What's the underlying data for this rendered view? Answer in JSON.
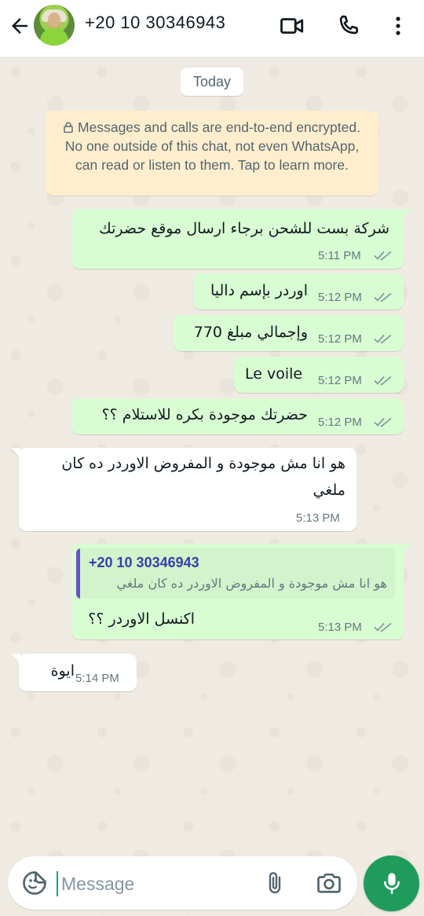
{
  "header": {
    "contact_name": "+20 10 30346943",
    "icons": [
      "back-arrow-icon",
      "avatar",
      "video-call-icon",
      "phone-icon",
      "more-vert-icon"
    ]
  },
  "chat": {
    "date_chip": "Today",
    "encryption_notice": "Messages and calls are end-to-end encrypted. No one outside of this chat, not even WhatsApp, can read or listen to them. Tap to learn more.",
    "messages": [
      {
        "direction": "outgoing",
        "text": "شركة بست للشحن برجاء ارسال موقع حضرتك",
        "time": "5:11 PM",
        "status": "read"
      },
      {
        "direction": "outgoing",
        "text": "اوردر بإسم داليا",
        "time": "5:12 PM",
        "status": "read"
      },
      {
        "direction": "outgoing",
        "text": "وإجمالي مبلغ 770",
        "time": "5:12 PM",
        "status": "read"
      },
      {
        "direction": "outgoing",
        "text": "Le voile",
        "time": "5:12 PM",
        "status": "read"
      },
      {
        "direction": "outgoing",
        "text": "حضرتك موجودة بكره للاستلام ؟؟",
        "time": "5:12 PM",
        "status": "read"
      },
      {
        "direction": "incoming",
        "line1": "هو انا مش موجودة و المفروض الاوردر ده كان",
        "line2": "ملغي",
        "time": "5:13 PM"
      },
      {
        "direction": "outgoing",
        "quote_author": "+20 10 30346943",
        "quote_text": "هو انا مش موجودة و المفروض الاوردر ده كان ملغي",
        "text": "اكنسل الاوردر ؟؟",
        "time": "5:13 PM",
        "status": "read"
      },
      {
        "direction": "incoming",
        "text": "ايوة",
        "time": "5:14 PM"
      }
    ]
  },
  "composer": {
    "placeholder": "Message",
    "value": ""
  },
  "colors": {
    "outgoing_bubble": "#d9fdd3",
    "incoming_bubble": "#ffffff",
    "accent": "#00a884",
    "mic_button": "#1f9c5c",
    "read_ticks": "#8696a0",
    "quote_bar": "#6c4fd4"
  }
}
